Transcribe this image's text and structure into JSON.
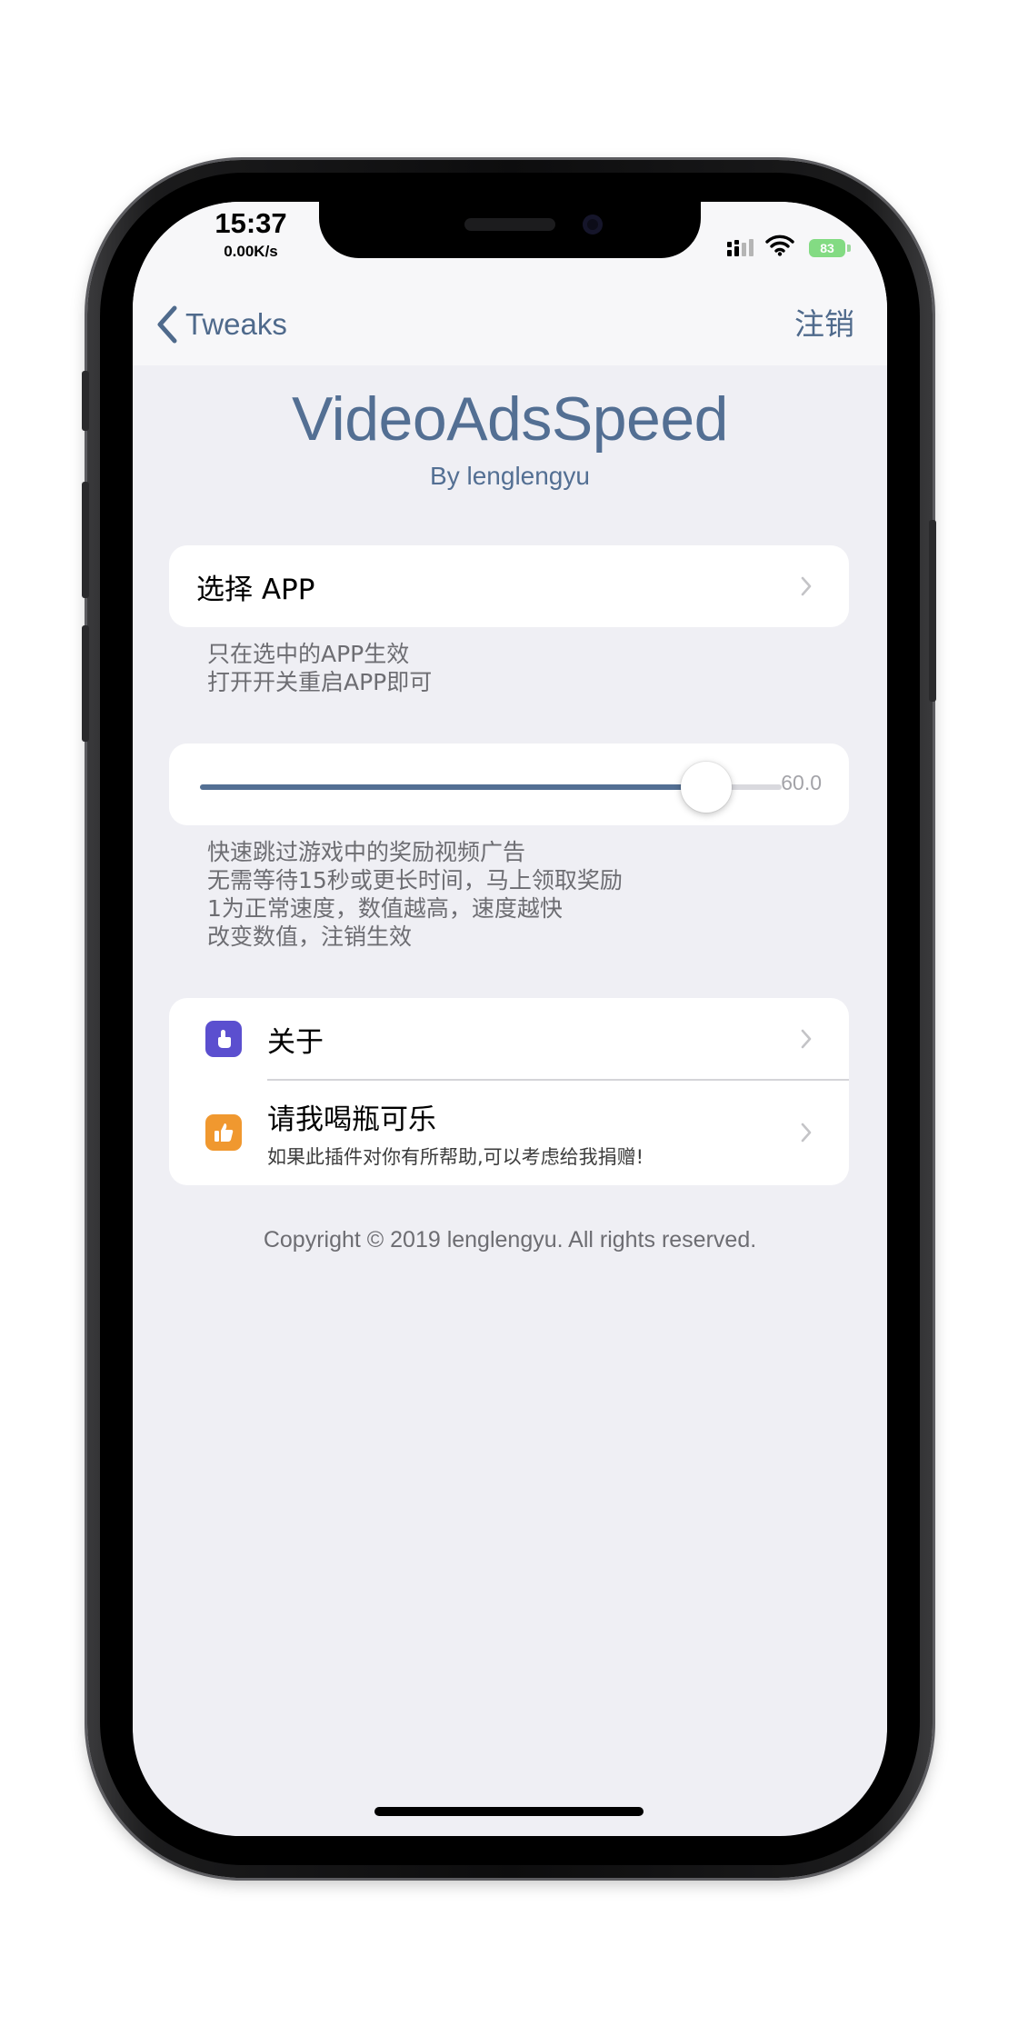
{
  "status_bar": {
    "time": "15:37",
    "network_speed": "0.00K/s",
    "battery": "83"
  },
  "nav": {
    "back_label": "Tweaks",
    "logout_label": "注销"
  },
  "header": {
    "title": "VideoAdsSpeed",
    "subtitle": "By lenglengyu"
  },
  "select_app": {
    "label": "选择 APP",
    "footer": [
      "只在选中的APP生效",
      "打开开关重启APP即可"
    ]
  },
  "speed_slider": {
    "value_label": "60.0",
    "value": 60,
    "fill_fraction": 0.87,
    "footer": [
      "快速跳过游戏中的奖励视频广告",
      "无需等待15秒或更长时间，马上领取奖励",
      "1为正常速度，数值越高，速度越快",
      "改变数值，注销生效"
    ]
  },
  "links": {
    "about": {
      "label": "关于",
      "icon": "hand-pointer-icon",
      "icon_color": "#5b4fcf"
    },
    "donate": {
      "label": "请我喝瓶可乐",
      "subtitle": "如果此插件对你有所帮助,可以考虑给我捐赠!",
      "icon": "thumbs-up-icon",
      "icon_color": "#f0982f"
    }
  },
  "copyright": "Copyright © 2019 lenglengyu. All rights reserved.",
  "colors": {
    "accent": "#536f93",
    "background": "#efeff4"
  }
}
